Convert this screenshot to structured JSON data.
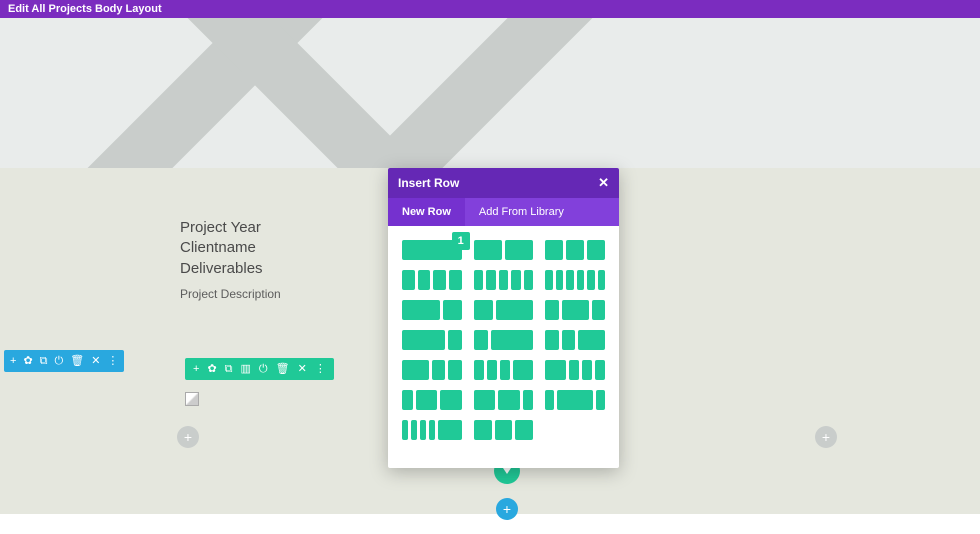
{
  "topbar": {
    "title": "Edit All Projects Body Layout"
  },
  "text_block": {
    "line1": "Project Year",
    "line2": "Clientname",
    "line3": "Deliverables",
    "desc": "Project Description"
  },
  "section_toolbar": {
    "add": "+",
    "gear": "✿",
    "dup": "⧉",
    "power": "⏻",
    "trash": "🗑",
    "close": "✕",
    "more": "⋮"
  },
  "row_toolbar": {
    "add": "+",
    "gear": "✿",
    "dup": "⧉",
    "cols": "▥",
    "power": "⏻",
    "trash": "🗑",
    "close": "✕",
    "more": "⋮"
  },
  "panel": {
    "title": "Insert Row",
    "close": "✕",
    "tabs": {
      "new": "New Row",
      "lib": "Add From Library"
    },
    "badge": "1",
    "layouts": [
      [
        1
      ],
      [
        1,
        1
      ],
      [
        1,
        1,
        1
      ],
      [
        1,
        1,
        1,
        1
      ],
      [
        1,
        1,
        1,
        1,
        1
      ],
      [
        1,
        1,
        1,
        1,
        1,
        1
      ],
      [
        2,
        1
      ],
      [
        1,
        2
      ],
      [
        1,
        2,
        1
      ],
      [
        3,
        1
      ],
      [
        1,
        3
      ],
      [
        1,
        1,
        2
      ],
      [
        2,
        1,
        1
      ],
      [
        1,
        1,
        1,
        2
      ],
      [
        2,
        1,
        1,
        1
      ],
      [
        1,
        2,
        2
      ],
      [
        2,
        2,
        1
      ],
      [
        1,
        4,
        1
      ],
      [
        1,
        1,
        1,
        1,
        4
      ],
      [
        1,
        1,
        1
      ]
    ]
  },
  "buttons": {
    "plus": "+"
  }
}
